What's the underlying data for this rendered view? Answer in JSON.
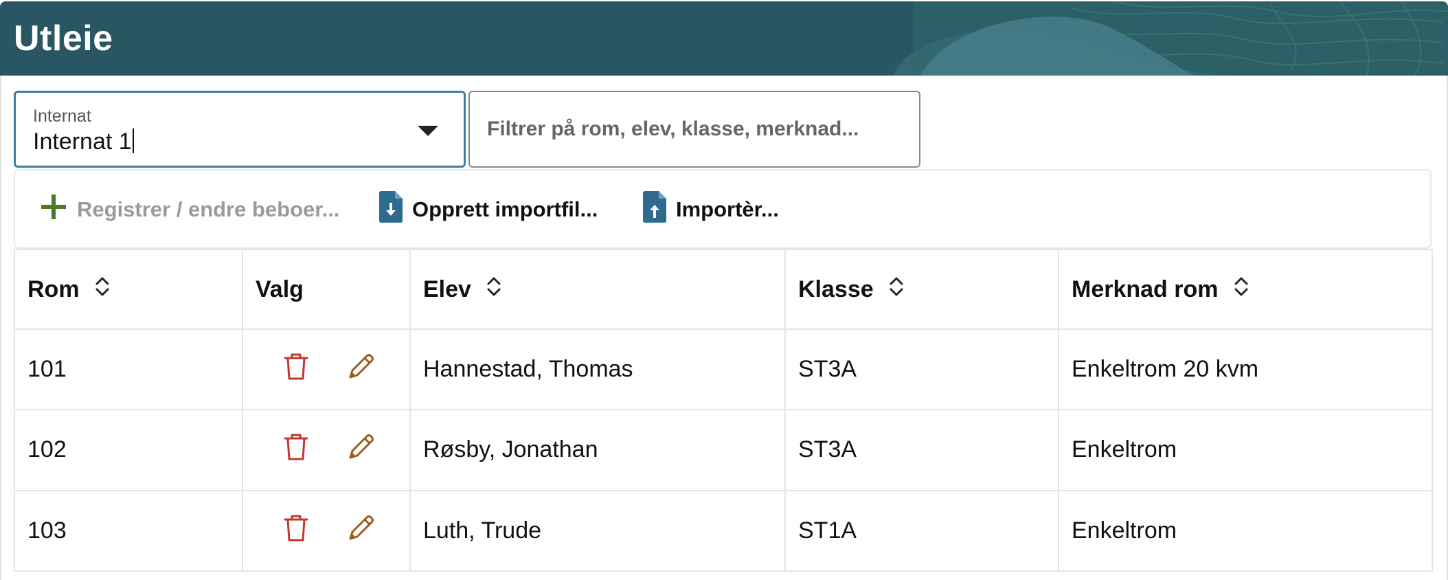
{
  "header": {
    "title": "Utleie"
  },
  "internat_select": {
    "label": "Internat",
    "value": "Internat 1"
  },
  "filter": {
    "placeholder": "Filtrer på rom, elev, klasse, merknad..."
  },
  "toolbar": {
    "register_label": "Registrer / endre beboer...",
    "create_import_label": "Opprett importfil...",
    "import_label": "Importèr..."
  },
  "table": {
    "columns": [
      "Rom",
      "Valg",
      "Elev",
      "Klasse",
      "Merknad rom"
    ],
    "rows": [
      {
        "rom": "101",
        "elev": "Hannestad, Thomas",
        "klasse": "ST3A",
        "merknad": "Enkeltrom 20 kvm"
      },
      {
        "rom": "102",
        "elev": "Røsby, Jonathan",
        "klasse": "ST3A",
        "merknad": "Enkeltrom"
      },
      {
        "rom": "103",
        "elev": "Luth, Trude",
        "klasse": "ST1A",
        "merknad": "Enkeltrom"
      }
    ]
  },
  "colors": {
    "header_bg": "#2a5663",
    "accent": "#3f7da3",
    "delete_icon": "#c0392b",
    "edit_icon": "#9a5b1e",
    "add_icon": "#4a7a2c",
    "file_icon": "#2f6b8e"
  },
  "icons": {
    "add": "plus-icon",
    "create_import": "file-download-icon",
    "import": "file-upload-icon",
    "sort": "sort-updown-icon",
    "delete": "trash-icon",
    "edit": "pencil-icon"
  }
}
